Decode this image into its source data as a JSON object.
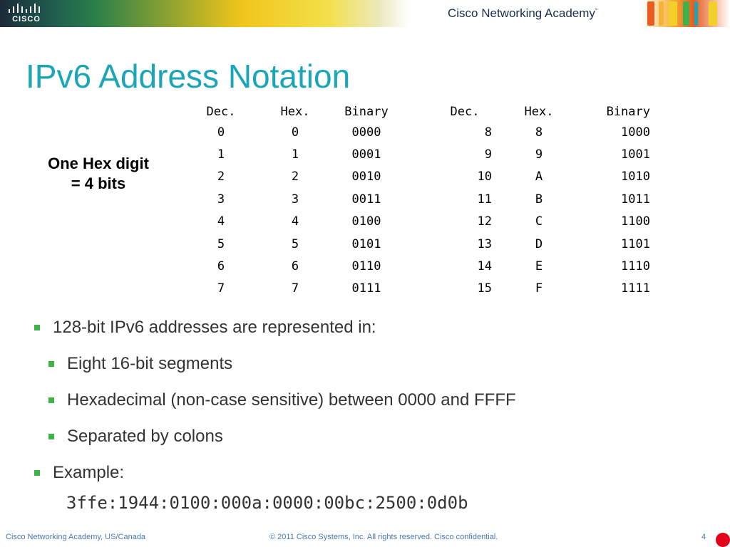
{
  "header": {
    "logo_text": "CISCO",
    "academy_label": "Cisco Networking Academy",
    "academy_mark": "°"
  },
  "slide": {
    "title": "IPv6 Address Notation",
    "side_note_line1": "One Hex digit",
    "side_note_line2": "= 4 bits"
  },
  "table": {
    "headers": [
      "Dec.",
      "Hex.",
      "Binary",
      "Dec.",
      "Hex.",
      "Binary"
    ],
    "rows": [
      [
        "0",
        "0",
        "0000",
        "8",
        "8",
        "1000"
      ],
      [
        "1",
        "1",
        "0001",
        "9",
        "9",
        "1001"
      ],
      [
        "2",
        "2",
        "0010",
        "10",
        "A",
        "1010"
      ],
      [
        "3",
        "3",
        "0011",
        "11",
        "B",
        "1011"
      ],
      [
        "4",
        "4",
        "0100",
        "12",
        "C",
        "1100"
      ],
      [
        "5",
        "5",
        "0101",
        "13",
        "D",
        "1101"
      ],
      [
        "6",
        "6",
        "0110",
        "14",
        "E",
        "1110"
      ],
      [
        "7",
        "7",
        "0111",
        "15",
        "F",
        "1111"
      ]
    ]
  },
  "bullets": [
    {
      "text": "128-bit IPv6 addresses are represented in:",
      "level": 1
    },
    {
      "text": "Eight 16-bit segments",
      "level": 2
    },
    {
      "text": "Hexadecimal (non-case sensitive) between 0000 and FFFF",
      "level": 2
    },
    {
      "text": "Separated by colons",
      "level": 2
    },
    {
      "text": "Example:",
      "level": 1
    }
  ],
  "example_address": "3ffe:1944:0100:000a:0000:00bc:2500:0d0b",
  "footer": {
    "left": "Cisco Networking Academy, US/Canada",
    "middle": "© 2011 Cisco Systems, Inc. All rights reserved. Cisco confidential.",
    "page_number": "4"
  },
  "colors": {
    "title": "#1aa5b8",
    "bullet_square": "#3db34a",
    "footer_text": "#4a78b0",
    "red_dot": "#e2001a"
  }
}
